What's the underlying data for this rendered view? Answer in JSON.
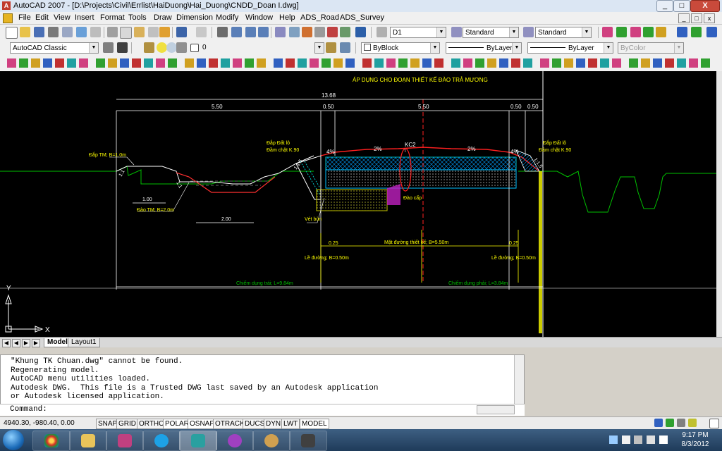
{
  "window": {
    "title": "AutoCAD 2007 - [D:\\Projects\\Civil\\Errlist\\HaiDuong\\Hai_Duong\\CNDD_Doan I.dwg]",
    "min": "_",
    "max": "□",
    "close": "X"
  },
  "menu": [
    "File",
    "Edit",
    "View",
    "Insert",
    "Format",
    "Tools",
    "Draw",
    "Dimension",
    "Modify",
    "Window",
    "Help",
    "ADS_Road",
    "ADS_Survey"
  ],
  "doc_controls": [
    "_",
    "□",
    "x"
  ],
  "toolbar1": {
    "layer_combo": "D1",
    "text_style": "Standard",
    "dim_style": "Standard"
  },
  "toolbar2": {
    "workspace": "AutoCAD Classic",
    "layer": "0",
    "color": "ByBlock",
    "linetype": "ByLayer",
    "lineweight": "ByLayer",
    "plotstyle": "ByColor"
  },
  "drawing": {
    "title": "ÁP DỤNG CHO ĐOẠN THIẾT KẾ ĐÀO TRẢ MƯƠNG",
    "dim_total": "13.68",
    "dim_left": "5.50",
    "dim_mid1": "0.50",
    "dim_mid2": "5.50",
    "dim_r1": "0.50",
    "dim_r2": "0.50",
    "label_cl": "KC2",
    "slope_l": "4%",
    "slope_cl": "2%",
    "slope_cr": "2%",
    "slope_r": "4%",
    "ratio_1": "1:1",
    "ratio_2": "1:1",
    "ratio_3": "1:1.5",
    "ratio_4": "1:1.5",
    "note_left_top": "Đắp TM; B=1.0m",
    "note_left_bot": "Đào TM; B=2.0m",
    "note_fill_l1": "Đắp Đất lô",
    "note_fill_l2": "Đầm chặt K.90",
    "note_fill_r1": "Đắp Đất lô",
    "note_fill_r2": "Đầm chặt K.90",
    "note_bin": "Vét bùn",
    "note_coc": "Đào cấp",
    "dim_100": "1.00",
    "dim_200": "2.00",
    "note_road": "Mặt đường thiết kế; B=5.50m",
    "dim_025l": "0.25",
    "dim_025r": "0.25",
    "note_le_l": "Lề đường; B=0.50m",
    "note_le_r": "Lề đường; B=0.50m",
    "note_occ_l": "Chiếm dụng trái; L=9.84m",
    "note_occ_r": "Chiếm dụng phải; L=3.84m",
    "ucs_x": "X",
    "ucs_y": "Y"
  },
  "tabs": [
    "Model",
    "Layout1"
  ],
  "command_history": "\"Khung TK Chuan.dwg\" cannot be found.\nRegenerating model.\nAutoCAD menu utilities loaded.\nAutodesk DWG.  This file is a Trusted DWG last saved by an Autodesk application\nor Autodesk licensed application.",
  "command_prompt": "Command:",
  "status": {
    "coords": "4940.30, -980.40, 0.00",
    "toggles": [
      "SNAP",
      "GRID",
      "ORTHO",
      "POLAR",
      "OSNAP",
      "OTRACK",
      "DUCS",
      "DYN",
      "LWT",
      "MODEL"
    ]
  },
  "clock": {
    "time": "9:17 PM",
    "date": "8/3/2012"
  },
  "colors": {
    "canvas": "#000000",
    "road_red": "#ff2020",
    "dim_white": "#ffffff",
    "ground_green": "#00c000",
    "annot_yellow": "#ffff00"
  }
}
